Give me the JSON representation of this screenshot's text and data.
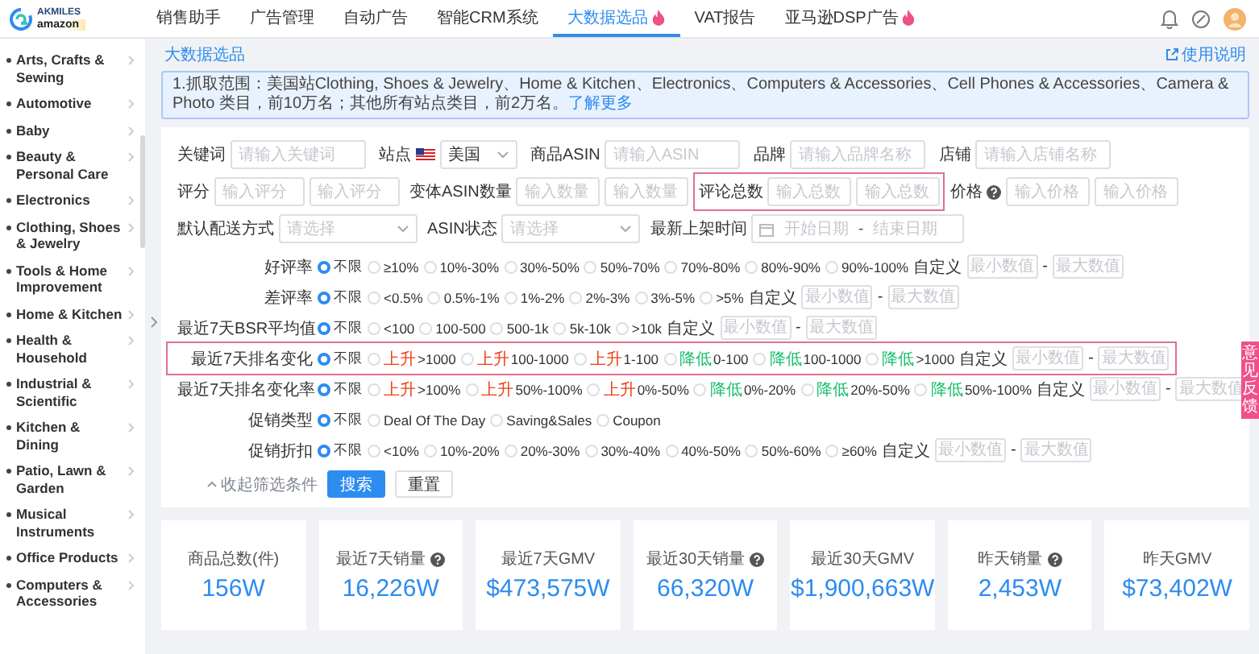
{
  "logo": {
    "line_1": "AKMILES",
    "line_2": "amazon"
  },
  "nav": [
    {
      "label": "销售助手",
      "selected": false,
      "hot": false
    },
    {
      "label": "广告管理",
      "selected": false,
      "hot": false
    },
    {
      "label": "自动广告",
      "selected": false,
      "hot": false
    },
    {
      "label": "智能CRM系统",
      "selected": false,
      "hot": false
    },
    {
      "label": "大数据选品",
      "selected": true,
      "hot": true
    },
    {
      "label": "VAT报告",
      "selected": false,
      "hot": false
    },
    {
      "label": "亚马逊DSP广告",
      "selected": false,
      "hot": true
    }
  ],
  "sidebar": {
    "items": [
      {
        "label": "Arts, Crafts & Sewing"
      },
      {
        "label": "Automotive"
      },
      {
        "label": "Baby"
      },
      {
        "label": "Beauty & Personal Care"
      },
      {
        "label": "Electronics"
      },
      {
        "label": "Clothing, Shoes & Jewelry"
      },
      {
        "label": "Tools & Home Improvement"
      },
      {
        "label": "Home & Kitchen"
      },
      {
        "label": "Health & Household"
      },
      {
        "label": "Industrial & Scientific"
      },
      {
        "label": "Kitchen & Dining"
      },
      {
        "label": "Patio, Lawn & Garden"
      },
      {
        "label": "Musical Instruments"
      },
      {
        "label": "Office Products"
      },
      {
        "label": "Computers & Accessories"
      }
    ]
  },
  "breadcrumb": "大数据选品",
  "help_link": "使用说明",
  "notice": {
    "text": "1.抓取范围：美国站Clothing, Shoes & Jewelry、Home & Kitchen、Electronics、Computers & Accessories、Cell Phones & Accessories、Camera & Photo 类目，前10万名；其他所有站点类目，前2万名。",
    "link": "了解更多"
  },
  "filters": {
    "rows": [
      {
        "fields": [
          {
            "kind": "text",
            "label": "关键词",
            "placeholder": "请输入关键词"
          },
          {
            "kind": "site",
            "label": "站点",
            "value": "美国"
          },
          {
            "kind": "text",
            "label": "商品ASIN",
            "placeholder": "请输入ASIN"
          },
          {
            "kind": "text",
            "label": "品牌",
            "placeholder": "请输入品牌名称"
          },
          {
            "kind": "text",
            "label": "店铺",
            "placeholder": "请输入店铺名称"
          }
        ]
      },
      {
        "fields": [
          {
            "kind": "range",
            "label": "评分",
            "placeholders": [
              "输入评分",
              "输入评分"
            ],
            "highlighted": false,
            "info": false
          },
          {
            "kind": "range",
            "label": "变体ASIN数量",
            "placeholders": [
              "输入数量",
              "输入数量"
            ],
            "highlighted": false,
            "info": false
          },
          {
            "kind": "range",
            "label": "评论总数",
            "placeholders": [
              "输入总数",
              "输入总数"
            ],
            "highlighted": true,
            "info": false
          },
          {
            "kind": "range",
            "label": "价格",
            "placeholders": [
              "输入价格",
              "输入价格"
            ],
            "highlighted": false,
            "info": true
          }
        ]
      },
      {
        "fields": [
          {
            "kind": "select",
            "label": "默认配送方式",
            "placeholder": "请选择"
          },
          {
            "kind": "select",
            "label": "ASIN状态",
            "placeholder": "请选择"
          },
          {
            "kind": "date",
            "label": "最新上架时间",
            "start": "开始日期",
            "separator": "-",
            "end": "结束日期"
          }
        ]
      }
    ]
  },
  "option_rows": [
    {
      "label": "好评率",
      "highlighted": false,
      "options": [
        {
          "text": "不限",
          "selected": true
        },
        {
          "text": "≥10%",
          "selected": false
        },
        {
          "text": "10%-30%",
          "selected": false
        },
        {
          "text": "30%-50%",
          "selected": false
        },
        {
          "text": "50%-70%",
          "selected": false
        },
        {
          "text": "70%-80%",
          "selected": false
        },
        {
          "text": "80%-90%",
          "selected": false
        },
        {
          "text": "90%-100%",
          "selected": false
        }
      ],
      "custom": {
        "label": "自定义",
        "placeholders": [
          "最小数值",
          "最大数值"
        ],
        "separator": "-"
      }
    },
    {
      "label": "差评率",
      "highlighted": false,
      "options": [
        {
          "text": "不限",
          "selected": true
        },
        {
          "text": "<0.5%",
          "selected": false
        },
        {
          "text": "0.5%-1%",
          "selected": false
        },
        {
          "text": "1%-2%",
          "selected": false
        },
        {
          "text": "2%-3%",
          "selected": false
        },
        {
          "text": "3%-5%",
          "selected": false
        },
        {
          "text": ">5%",
          "selected": false
        }
      ],
      "custom": {
        "label": "自定义",
        "placeholders": [
          "最小数值",
          "最大数值"
        ],
        "separator": "-"
      }
    },
    {
      "label": "最近7天BSR平均值",
      "highlighted": false,
      "options": [
        {
          "text": "不限",
          "selected": true
        },
        {
          "text": "<100",
          "selected": false
        },
        {
          "text": "100-500",
          "selected": false
        },
        {
          "text": "500-1k",
          "selected": false
        },
        {
          "text": "5k-10k",
          "selected": false
        },
        {
          "text": ">10k",
          "selected": false
        }
      ],
      "custom": {
        "label": "自定义",
        "placeholders": [
          "最小数值",
          "最大数值"
        ],
        "separator": "-"
      }
    },
    {
      "label": "最近7天排名变化",
      "highlighted": true,
      "options": [
        {
          "text": "不限",
          "selected": true
        },
        {
          "kind": "rise",
          "tag": "上升",
          "text": ">1000",
          "selected": false
        },
        {
          "kind": "rise",
          "tag": "上升",
          "text": "100-1000",
          "selected": false
        },
        {
          "kind": "rise",
          "tag": "上升",
          "text": "1-100",
          "selected": false
        },
        {
          "kind": "fall",
          "tag": "降低",
          "text": "0-100",
          "selected": false
        },
        {
          "kind": "fall",
          "tag": "降低",
          "text": "100-1000",
          "selected": false
        },
        {
          "kind": "fall",
          "tag": "降低",
          "text": ">1000",
          "selected": false
        }
      ],
      "custom": {
        "label": "自定义",
        "placeholders": [
          "最小数值",
          "最大数值"
        ],
        "separator": "-"
      }
    },
    {
      "label": "最近7天排名变化率",
      "highlighted": false,
      "options": [
        {
          "text": "不限",
          "selected": true
        },
        {
          "kind": "rise",
          "tag": "上升",
          "text": ">100%",
          "selected": false
        },
        {
          "kind": "rise",
          "tag": "上升",
          "text": "50%-100%",
          "selected": false
        },
        {
          "kind": "rise",
          "tag": "上升",
          "text": "0%-50%",
          "selected": false
        },
        {
          "kind": "fall",
          "tag": "降低",
          "text": "0%-20%",
          "selected": false
        },
        {
          "kind": "fall",
          "tag": "降低",
          "text": "20%-50%",
          "selected": false
        },
        {
          "kind": "fall",
          "tag": "降低",
          "text": "50%-100%",
          "selected": false
        }
      ],
      "custom": {
        "label": "自定义",
        "placeholders": [
          "最小数值",
          "最大数值"
        ],
        "separator": "-"
      }
    },
    {
      "label": "促销类型",
      "highlighted": false,
      "options": [
        {
          "text": "不限",
          "selected": true
        },
        {
          "text": "Deal Of The Day",
          "selected": false
        },
        {
          "text": "Saving&Sales",
          "selected": false
        },
        {
          "text": "Coupon",
          "selected": false
        }
      ]
    },
    {
      "label": "促销折扣",
      "highlighted": false,
      "options": [
        {
          "text": "不限",
          "selected": true
        },
        {
          "text": "<10%",
          "selected": false
        },
        {
          "text": "10%-20%",
          "selected": false
        },
        {
          "text": "20%-30%",
          "selected": false
        },
        {
          "text": "30%-40%",
          "selected": false
        },
        {
          "text": "40%-50%",
          "selected": false
        },
        {
          "text": "50%-60%",
          "selected": false
        },
        {
          "text": "≥60%",
          "selected": false
        }
      ],
      "custom": {
        "label": "自定义",
        "placeholders": [
          "最小数值",
          "最大数值"
        ],
        "separator": "-"
      }
    }
  ],
  "collapse": "收起筛选条件",
  "buttons": [
    {
      "label": "搜索",
      "kind": "primary"
    },
    {
      "label": "重置",
      "kind": "default"
    }
  ],
  "stats": [
    {
      "label": "商品总数(件)",
      "value": "156W",
      "info": false
    },
    {
      "label": "最近7天销量",
      "value": "16,226W",
      "info": true
    },
    {
      "label": "最近7天GMV",
      "value": "$473,575W",
      "info": false
    },
    {
      "label": "最近30天销量",
      "value": "66,320W",
      "info": true
    },
    {
      "label": "最近30天GMV",
      "value": "$1,900,663W",
      "info": false
    },
    {
      "label": "昨天销量",
      "value": "2,453W",
      "info": true
    },
    {
      "label": "昨天GMV",
      "value": "$73,402W",
      "info": false
    }
  ],
  "feedback_tab": "意见反馈"
}
